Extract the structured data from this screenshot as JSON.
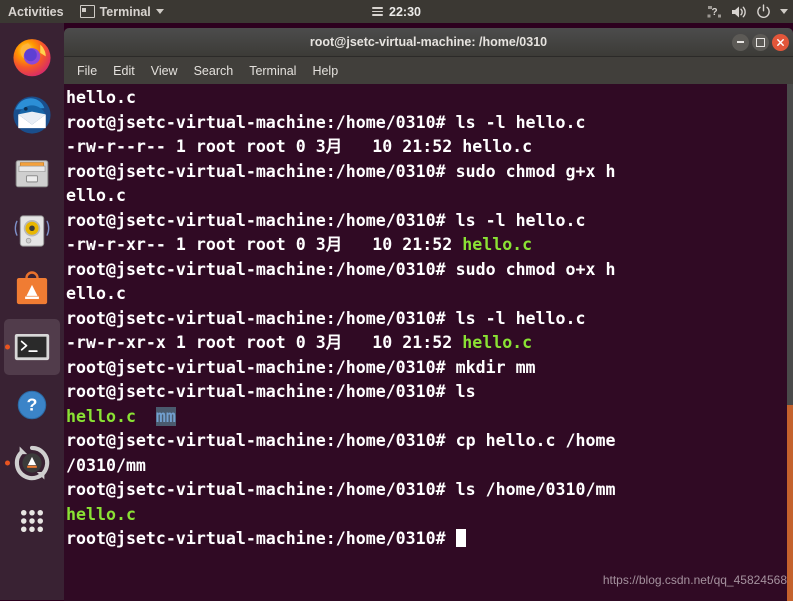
{
  "colors": {
    "topbar_bg": "#3b3833",
    "dock_bg": "#3a2334",
    "terminal_bg": "#300a24",
    "terminal_fg": "#ffffff",
    "green": "#8ae234",
    "blue": "#729fcf",
    "accent_orange": "#e95420",
    "close_red": "#e2563a"
  },
  "topbar": {
    "activities": "Activities",
    "app_menu": "Terminal",
    "app_icon": "terminal-window-icon",
    "app_caret": "chevron-down-icon",
    "clock": "22:30",
    "clock_icon": "list-menu-icon",
    "indicators": [
      {
        "name": "keyboard-help-icon",
        "glyph": "?"
      },
      {
        "name": "volume-icon",
        "glyph": "speaker"
      },
      {
        "name": "power-icon",
        "glyph": "power"
      },
      {
        "name": "chevron-down-icon",
        "glyph": "caret"
      }
    ]
  },
  "dock": {
    "items": [
      {
        "name": "dock-item-firefox",
        "label": "Firefox",
        "icon": "firefox-icon",
        "running": false,
        "active": false
      },
      {
        "name": "dock-item-thunderbird",
        "label": "Thunderbird Mail",
        "icon": "thunderbird-icon",
        "running": false,
        "active": false
      },
      {
        "name": "dock-item-files",
        "label": "Files",
        "icon": "file-manager-icon",
        "running": false,
        "active": false
      },
      {
        "name": "dock-item-rhythmbox",
        "label": "Rhythmbox",
        "icon": "music-player-icon",
        "running": false,
        "active": false
      },
      {
        "name": "dock-item-ubuntu-software",
        "label": "Ubuntu Software",
        "icon": "software-store-icon",
        "running": false,
        "active": false
      },
      {
        "name": "dock-item-terminal",
        "label": "Terminal",
        "icon": "terminal-icon",
        "running": true,
        "active": true
      },
      {
        "name": "dock-item-help",
        "label": "Help",
        "icon": "question-mark-icon",
        "running": false,
        "active": false
      },
      {
        "name": "dock-item-software-updater",
        "label": "Software Updater",
        "icon": "software-updater-icon",
        "running": true,
        "active": false
      },
      {
        "name": "dock-item-show-applications",
        "label": "Show Applications",
        "icon": "app-grid-icon",
        "running": false,
        "active": false
      }
    ]
  },
  "window": {
    "title": "root@jsetc-virtual-machine: /home/0310",
    "buttons": {
      "minimize": "minimize-button",
      "maximize": "maximize-button",
      "close": "close-button"
    },
    "menu": [
      "File",
      "Edit",
      "View",
      "Search",
      "Terminal",
      "Help"
    ]
  },
  "terminal": {
    "prompt": "root@jsetc-virtual-machine:/home/0310# ",
    "lines": [
      {
        "segments": [
          {
            "text": "hello.c",
            "color": "white"
          }
        ]
      },
      {
        "segments": [
          {
            "text": "root@jsetc-virtual-machine:/home/0310# ls -l hello.c",
            "color": "white"
          }
        ]
      },
      {
        "segments": [
          {
            "text": "-rw-r--r-- 1 root root 0 3月   10 21:52 hello.c",
            "color": "white"
          }
        ]
      },
      {
        "segments": [
          {
            "text": "root@jsetc-virtual-machine:/home/0310# sudo chmod g+x h",
            "color": "white"
          }
        ]
      },
      {
        "segments": [
          {
            "text": "ello.c",
            "color": "white"
          }
        ]
      },
      {
        "segments": [
          {
            "text": "root@jsetc-virtual-machine:/home/0310# ls -l hello.c",
            "color": "white"
          }
        ]
      },
      {
        "segments": [
          {
            "text": "-rw-r-xr-- 1 root root 0 3月   10 21:52 ",
            "color": "white"
          },
          {
            "text": "hello.c",
            "color": "green"
          }
        ]
      },
      {
        "segments": [
          {
            "text": "root@jsetc-virtual-machine:/home/0310# sudo chmod o+x h",
            "color": "white"
          }
        ]
      },
      {
        "segments": [
          {
            "text": "ello.c",
            "color": "white"
          }
        ]
      },
      {
        "segments": [
          {
            "text": "root@jsetc-virtual-machine:/home/0310# ls -l hello.c",
            "color": "white"
          }
        ]
      },
      {
        "segments": [
          {
            "text": "-rw-r-xr-x 1 root root 0 3月   10 21:52 ",
            "color": "white"
          },
          {
            "text": "hello.c",
            "color": "green"
          }
        ]
      },
      {
        "segments": [
          {
            "text": "root@jsetc-virtual-machine:/home/0310# mkdir mm",
            "color": "white"
          }
        ]
      },
      {
        "segments": [
          {
            "text": "root@jsetc-virtual-machine:/home/0310# ls",
            "color": "white"
          }
        ]
      },
      {
        "segments": [
          {
            "text": "hello.c",
            "color": "green"
          },
          {
            "text": "  ",
            "color": "white"
          },
          {
            "text": "mm",
            "color": "blue"
          }
        ]
      },
      {
        "segments": [
          {
            "text": "root@jsetc-virtual-machine:/home/0310# cp hello.c /home",
            "color": "white"
          }
        ]
      },
      {
        "segments": [
          {
            "text": "/0310/mm",
            "color": "white"
          }
        ]
      },
      {
        "segments": [
          {
            "text": "root@jsetc-virtual-machine:/home/0310# ls /home/0310/mm",
            "color": "white"
          }
        ]
      },
      {
        "segments": [
          {
            "text": "hello.c",
            "color": "green"
          }
        ]
      },
      {
        "segments": [
          {
            "text": "root@jsetc-virtual-machine:/home/0310# ",
            "color": "white"
          },
          {
            "text": "",
            "cursor": true
          }
        ]
      }
    ],
    "scrollbar": {
      "thumb_top_pct": 62,
      "thumb_height_pct": 38
    }
  },
  "watermark": "https://blog.csdn.net/qq_45824568"
}
